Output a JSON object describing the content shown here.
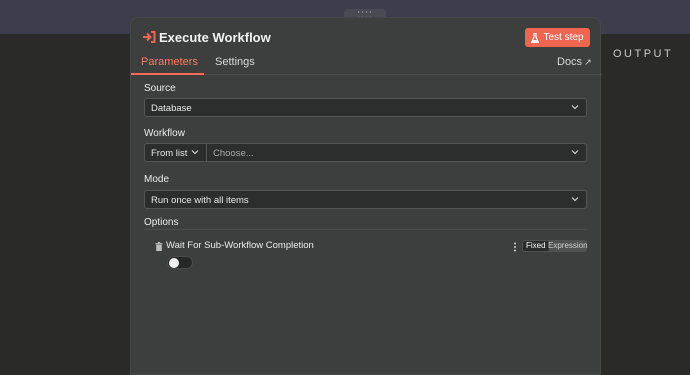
{
  "panel": {
    "title": "Execute Workflow",
    "test_step_label": "Test step",
    "output_label": "OUTPUT"
  },
  "tabs": [
    {
      "label": "Parameters",
      "active": true
    },
    {
      "label": "Settings",
      "active": false
    }
  ],
  "docs_label": "Docs",
  "fields": {
    "source": {
      "label": "Source",
      "value": "Database"
    },
    "workflow": {
      "label": "Workflow",
      "mode_value": "From list",
      "placeholder": "Choose..."
    },
    "mode": {
      "label": "Mode",
      "value": "Run once with all items"
    }
  },
  "options": {
    "label": "Options",
    "items": [
      {
        "label": "Wait For Sub-Workflow Completion",
        "enabled": false
      }
    ],
    "value_modes": [
      "Fixed",
      "Expression"
    ],
    "selected_mode": "Fixed"
  },
  "colors": {
    "accent": "#ff6d5a",
    "panel_bg": "#3d3e3e",
    "input_bg": "#2c2d2d"
  },
  "icons": [
    "sign-in-icon",
    "flask-icon",
    "external-link-icon",
    "chevron-down-icon",
    "trash-icon",
    "kebab-icon",
    "drag-handle-icon"
  ]
}
